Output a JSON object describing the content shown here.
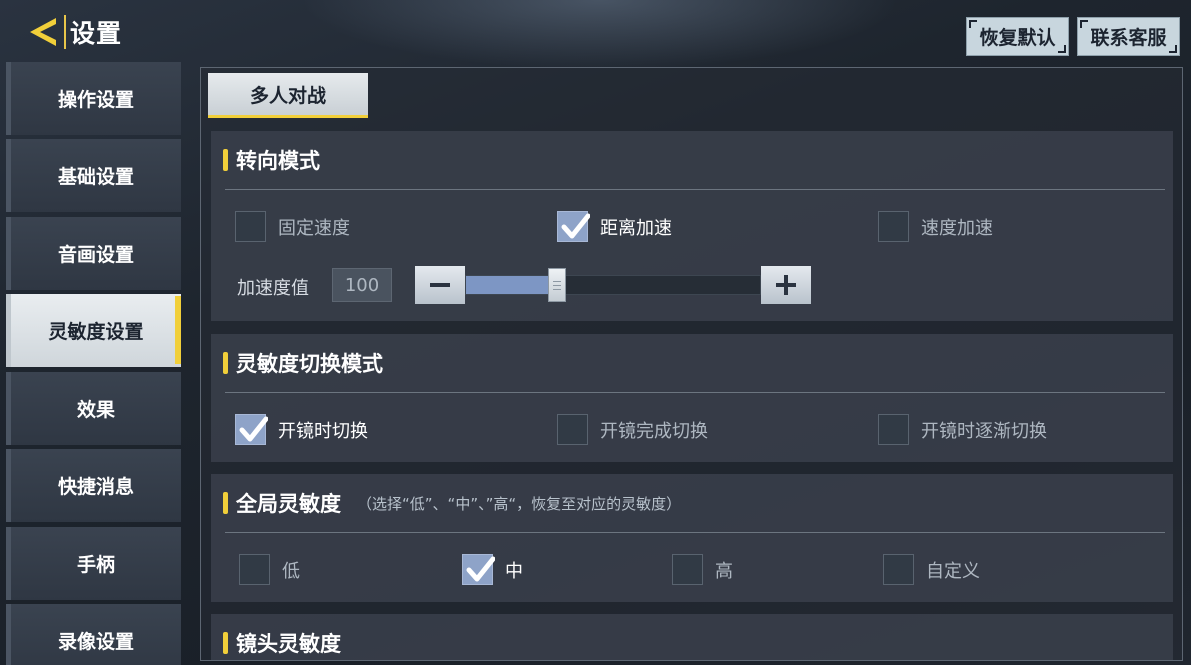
{
  "header": {
    "title": "设置",
    "restore_default_label": "恢复默认",
    "contact_service_label": "联系客服"
  },
  "sidebar": {
    "items": [
      {
        "label": "操作设置",
        "active": false
      },
      {
        "label": "基础设置",
        "active": false
      },
      {
        "label": "音画设置",
        "active": false
      },
      {
        "label": "灵敏度设置",
        "active": true
      },
      {
        "label": "效果",
        "active": false
      },
      {
        "label": "快捷消息",
        "active": false
      },
      {
        "label": "手柄",
        "active": false
      },
      {
        "label": "录像设置",
        "active": false
      }
    ]
  },
  "main": {
    "tab_label": "多人对战",
    "turn_mode": {
      "title": "转向模式",
      "options": [
        {
          "label": "固定速度",
          "checked": false
        },
        {
          "label": "距离加速",
          "checked": true
        },
        {
          "label": "速度加速",
          "checked": false
        }
      ],
      "accel_label": "加速度值",
      "accel_value": "100",
      "accel_fraction": 0.31
    },
    "switch_mode": {
      "title": "灵敏度切换模式",
      "options": [
        {
          "label": "开镜时切换",
          "checked": true
        },
        {
          "label": "开镜完成切换",
          "checked": false
        },
        {
          "label": "开镜时逐渐切换",
          "checked": false
        }
      ]
    },
    "global_sens": {
      "title": "全局灵敏度",
      "note": "（选择“低”、“中”、”高“，恢复至对应的灵敏度）",
      "options": [
        {
          "label": "低",
          "checked": false
        },
        {
          "label": "中",
          "checked": true
        },
        {
          "label": "高",
          "checked": false
        },
        {
          "label": "自定义",
          "checked": false
        }
      ]
    },
    "camera_sens": {
      "title": "镜头灵敏度"
    }
  },
  "colors": {
    "accent": "#f1cf3a",
    "check_fill": "#8ea3c8",
    "slider_fill": "#7d96c4"
  }
}
